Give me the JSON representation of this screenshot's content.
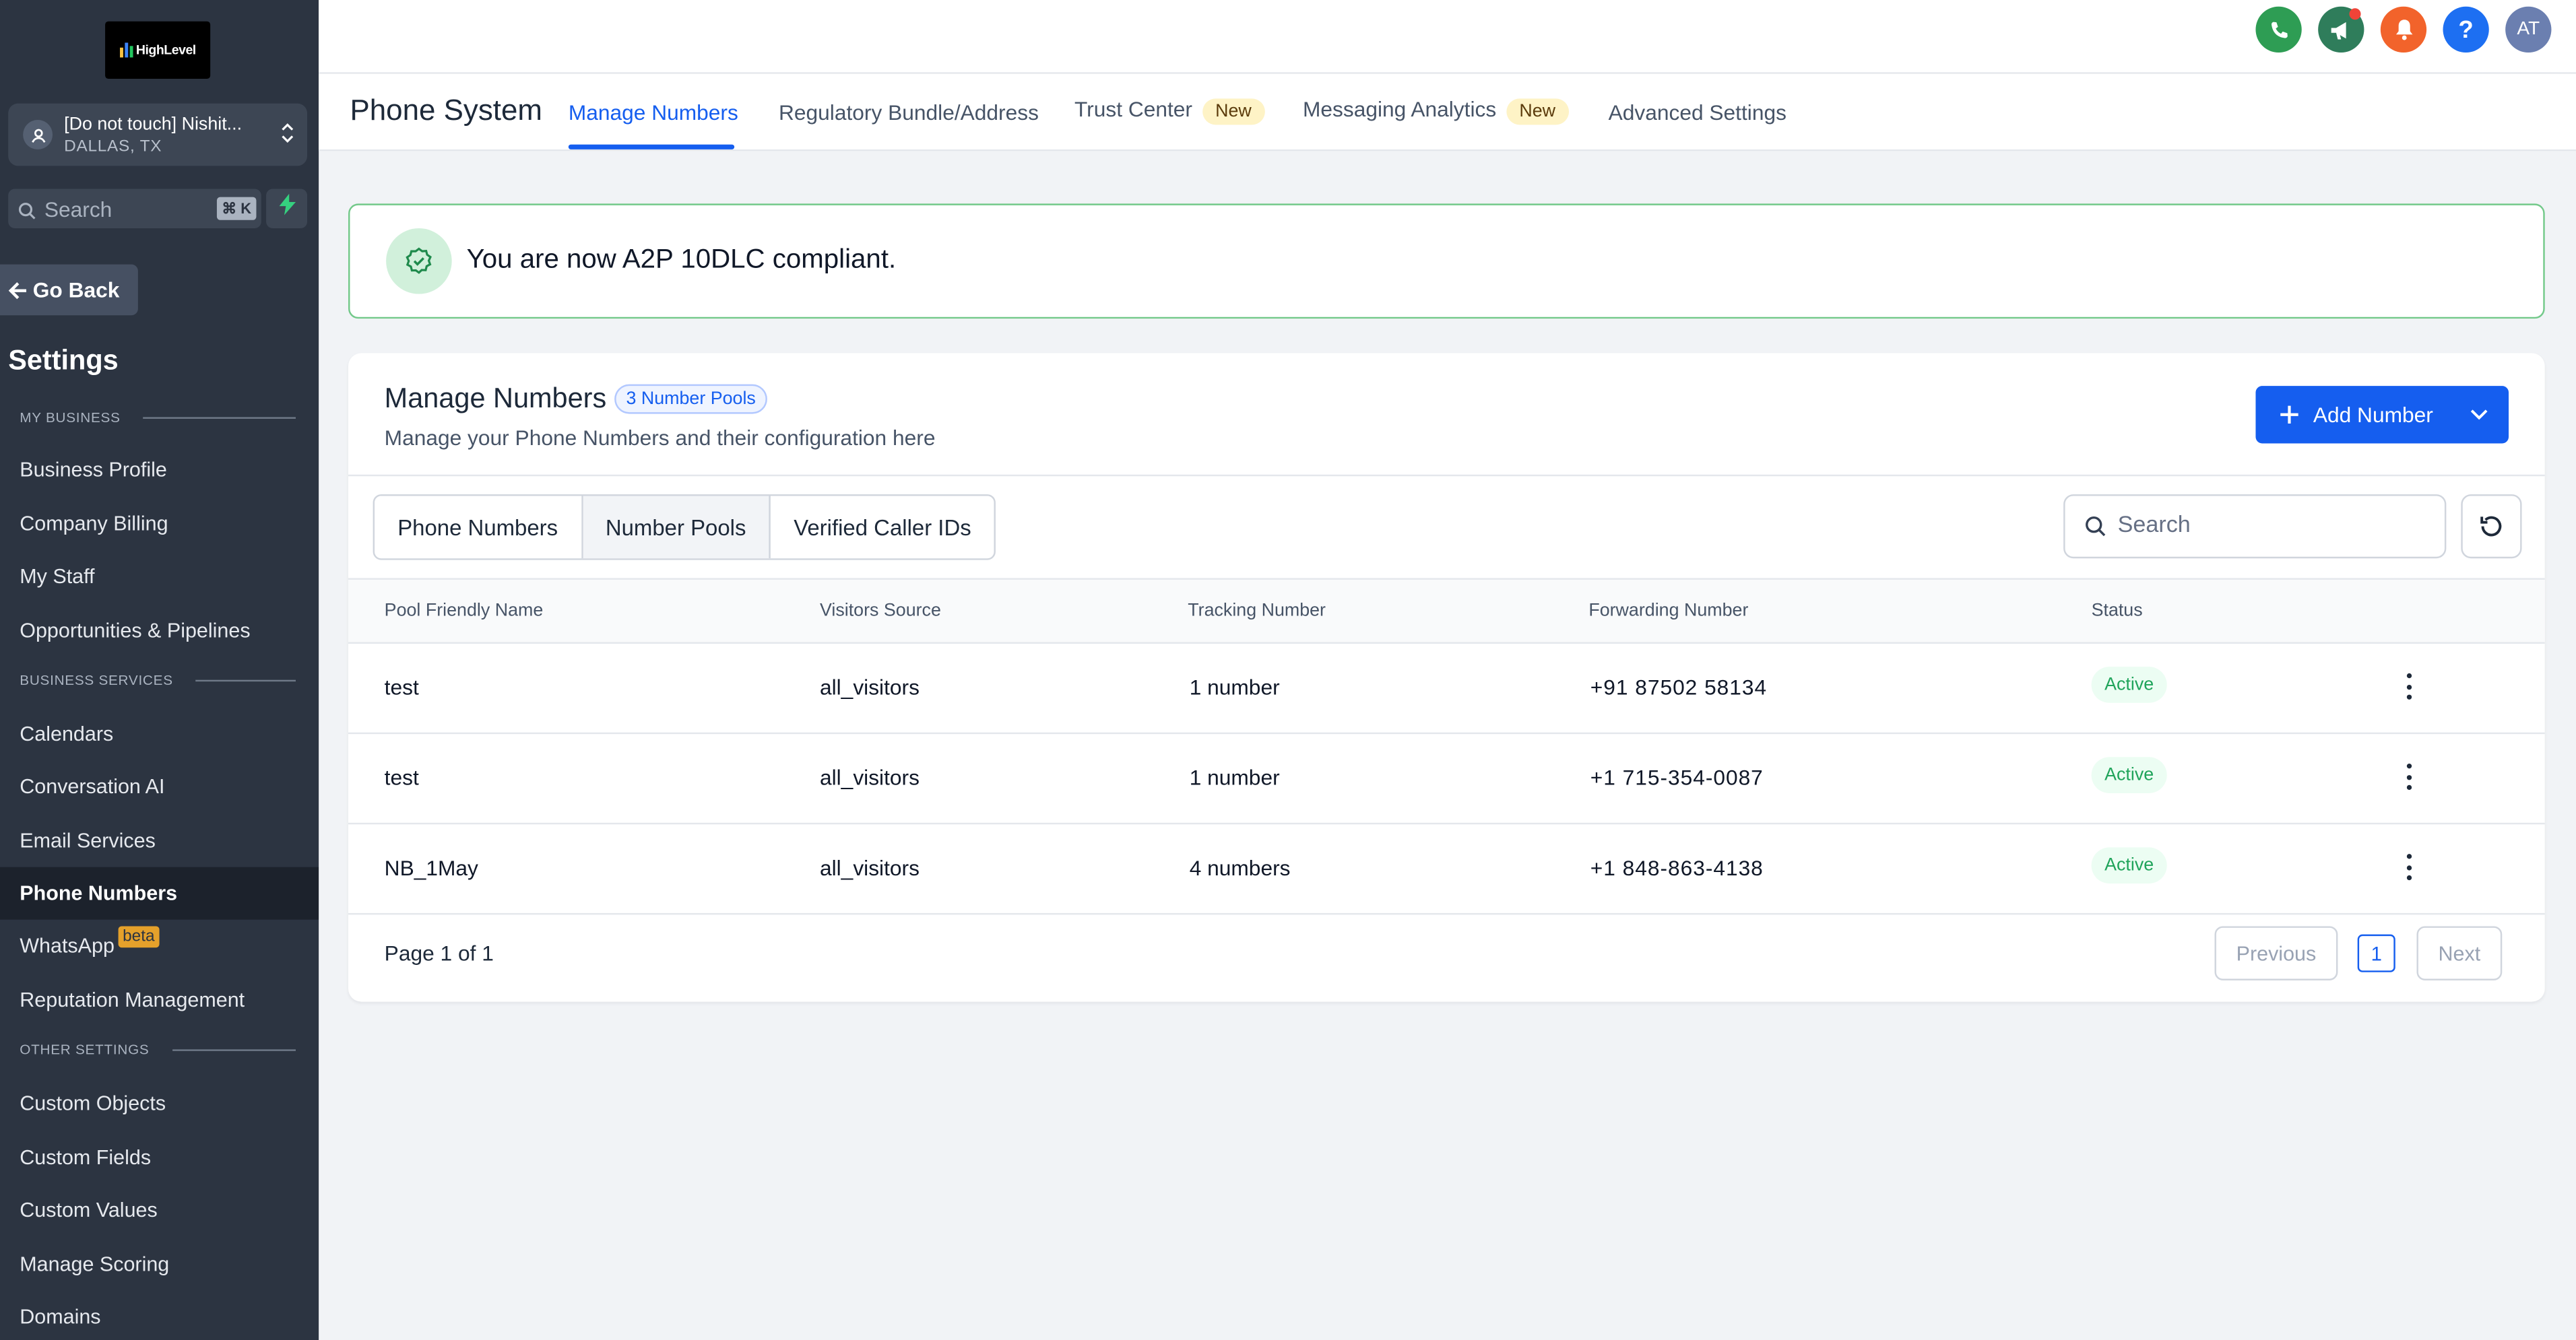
{
  "logo": {
    "text": "HighLevel"
  },
  "account": {
    "name": "[Do not touch] Nishit...",
    "location": "DALLAS, TX"
  },
  "sidebar_search": {
    "placeholder": "Search",
    "shortcut": "⌘ K"
  },
  "go_back": "Go Back",
  "settings_title": "Settings",
  "sections": {
    "my_business": "MY BUSINESS",
    "business_services": "BUSINESS SERVICES",
    "other_settings": "OTHER SETTINGS"
  },
  "nav": {
    "business_profile": "Business Profile",
    "company_billing": "Company Billing",
    "my_staff": "My Staff",
    "opportunities": "Opportunities & Pipelines",
    "calendars": "Calendars",
    "conversation_ai": "Conversation AI",
    "email_services": "Email Services",
    "phone_numbers": "Phone Numbers",
    "whatsapp": "WhatsApp",
    "whatsapp_badge": "beta",
    "reputation": "Reputation Management",
    "custom_objects": "Custom Objects",
    "custom_fields": "Custom Fields",
    "custom_values": "Custom Values",
    "manage_scoring": "Manage Scoring",
    "domains": "Domains"
  },
  "topbar": {
    "avatar_initials": "AT",
    "icons": [
      "phone-icon",
      "megaphone-icon",
      "bell-icon",
      "help-icon"
    ],
    "colors": {
      "phone": "#2e9d54",
      "megaphone": "#2f7d5b",
      "bell": "#f2632b",
      "help": "#1d6ff2",
      "avatar": "#6b7fb0"
    }
  },
  "page": {
    "title": "Phone System",
    "tabs": {
      "manage_numbers": "Manage Numbers",
      "regulatory": "Regulatory Bundle/Address",
      "trust_center": "Trust Center",
      "messaging_analytics": "Messaging Analytics",
      "advanced_settings": "Advanced Settings",
      "new_badge": "New"
    }
  },
  "banner": {
    "text": "You are now A2P 10DLC compliant."
  },
  "card": {
    "title": "Manage Numbers",
    "pool_badge": "3 Number Pools",
    "subtitle": "Manage your Phone Numbers and their configuration here",
    "add_button": "Add Number",
    "segments": {
      "phone_numbers": "Phone Numbers",
      "number_pools": "Number Pools",
      "verified_caller_ids": "Verified Caller IDs"
    },
    "search_placeholder": "Search"
  },
  "table": {
    "headers": {
      "name": "Pool Friendly Name",
      "source": "Visitors Source",
      "tracking": "Tracking Number",
      "forwarding": "Forwarding Number",
      "status": "Status"
    },
    "rows": [
      {
        "name": "test",
        "source": "all_visitors",
        "tracking": "1 number",
        "forwarding": "+91 87502 58134",
        "status": "Active"
      },
      {
        "name": "test",
        "source": "all_visitors",
        "tracking": "1 number",
        "forwarding": "+1 715-354-0087",
        "status": "Active"
      },
      {
        "name": "NB_1May",
        "source": "all_visitors",
        "tracking": "4 numbers",
        "forwarding": "+1 848-863-4138",
        "status": "Active"
      }
    ]
  },
  "pagination": {
    "info": "Page 1 of 1",
    "previous": "Previous",
    "current": "1",
    "next": "Next"
  }
}
